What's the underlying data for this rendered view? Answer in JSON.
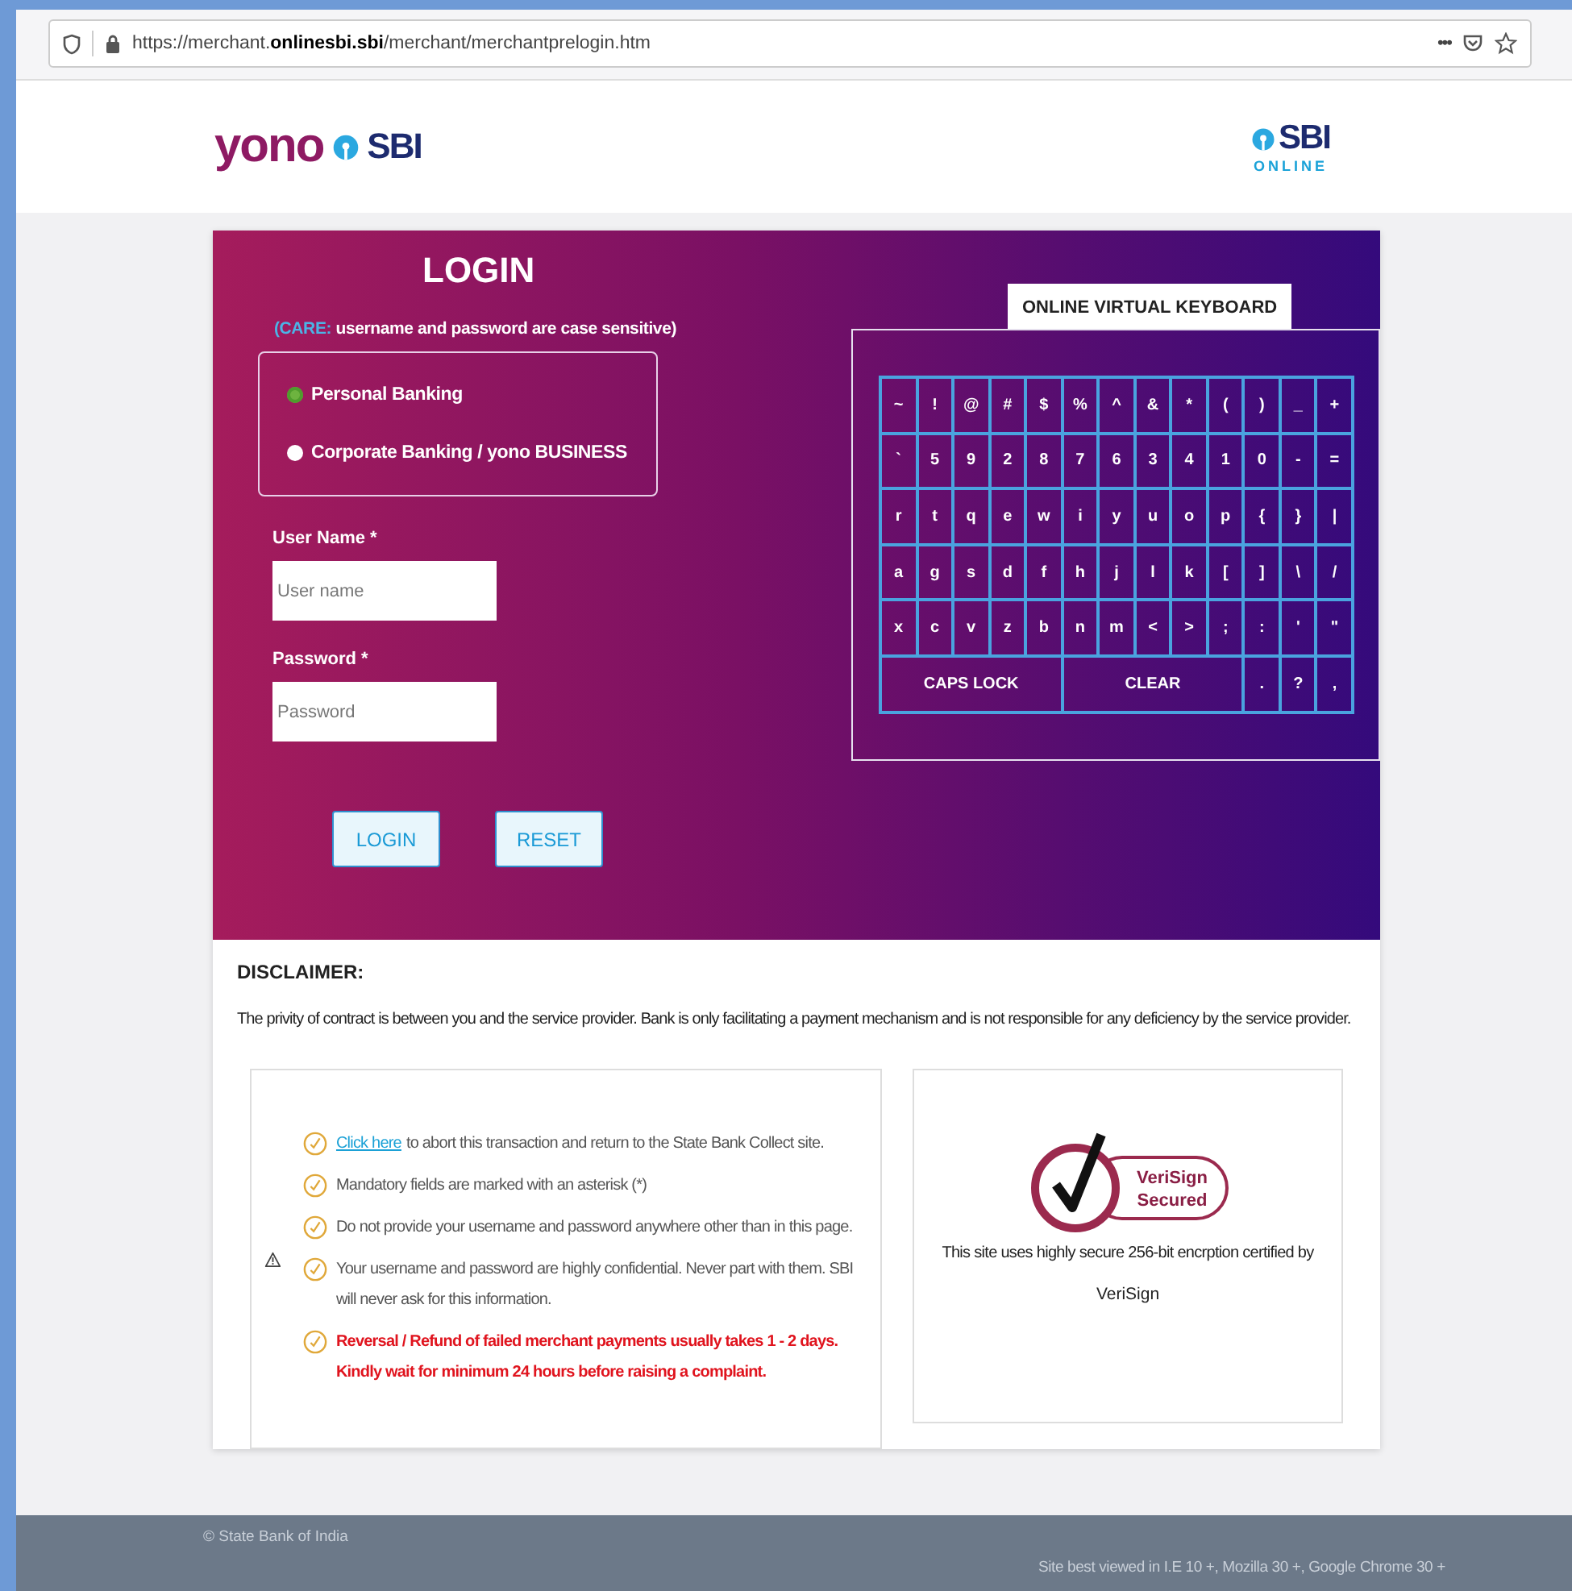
{
  "browser": {
    "url": "https://merchant.**onlinesbi.sbi**/merchant/merchantprelogin.htm",
    "menu": "•••"
  },
  "header": {
    "left_logo": {
      "word": "yono",
      "brand": "SBI"
    },
    "right_logo": {
      "brand": "SBI",
      "sub": "ONLINE"
    }
  },
  "login": {
    "title": "LOGIN",
    "care_label": "(CARE:",
    "care_text": "username and password are case sensitive)",
    "options": [
      {
        "label": "Personal Banking",
        "selected": true
      },
      {
        "label": "Corporate Banking / yono BUSINESS",
        "selected": false
      }
    ],
    "fields": [
      {
        "label": "User Name *",
        "placeholder": "User name"
      },
      {
        "label": "Password *",
        "placeholder": "Password"
      }
    ],
    "buttons": [
      "LOGIN",
      "RESET"
    ]
  },
  "keyboard": {
    "title": "ONLINE VIRTUAL KEYBOARD",
    "rows": [
      [
        "~",
        "!",
        "@",
        "#",
        "$",
        "%",
        "^",
        "&",
        "*",
        "(",
        ")",
        "_",
        "+"
      ],
      [
        "`",
        "5",
        "9",
        "2",
        "8",
        "7",
        "6",
        "3",
        "4",
        "1",
        "0",
        "-",
        "="
      ],
      [
        "r",
        "t",
        "q",
        "e",
        "w",
        "i",
        "y",
        "u",
        "o",
        "p",
        "{",
        "}",
        "|"
      ],
      [
        "a",
        "g",
        "s",
        "d",
        "f",
        "h",
        "j",
        "l",
        "k",
        "[",
        "]",
        "\\",
        "/"
      ],
      [
        "x",
        "c",
        "v",
        "z",
        "b",
        "n",
        "m",
        "<",
        ">",
        ";",
        ":",
        "'",
        "\""
      ]
    ],
    "bottom_row": [
      {
        "label": "CAPS LOCK",
        "kind": "wide"
      },
      {
        "label": "CLEAR",
        "kind": "wide"
      },
      {
        "label": ".",
        "kind": "key"
      },
      {
        "label": "?",
        "kind": "key"
      },
      {
        "label": ",",
        "kind": "key"
      }
    ]
  },
  "disclaimer": {
    "title": "DISCLAIMER:",
    "text": "The privity of contract is between you and the service provider. Bank is only facilitating a payment mechanism and is not responsible for any deficiency by the service provider."
  },
  "notes": [
    {
      "link": "Click here",
      "text": "to abort this transaction and return to the State Bank Collect site.",
      "alert": false
    },
    {
      "text": "Mandatory fields are marked with an asterisk (*)",
      "alert": false
    },
    {
      "text": "Do not provide your username and password anywhere other than in this page.",
      "alert": false
    },
    {
      "text": "Your username and password are highly confidential. Never part with them. SBI will never ask for this information.",
      "alert": false
    },
    {
      "text": "Reversal / Refund of failed merchant payments usually takes 1 - 2 days. Kindly wait for minimum 24 hours before raising a complaint.",
      "alert": true
    }
  ],
  "security": {
    "badge_lines": [
      "VeriSign",
      "Secured"
    ],
    "text": "This site uses highly secure 256-bit encrption certified by",
    "text_2": "VeriSign"
  },
  "footer": {
    "copyright": "© State Bank of India",
    "browsers": "Site best viewed in I.E 10 +, Mozilla 30 +, Google Chrome 30 +"
  }
}
